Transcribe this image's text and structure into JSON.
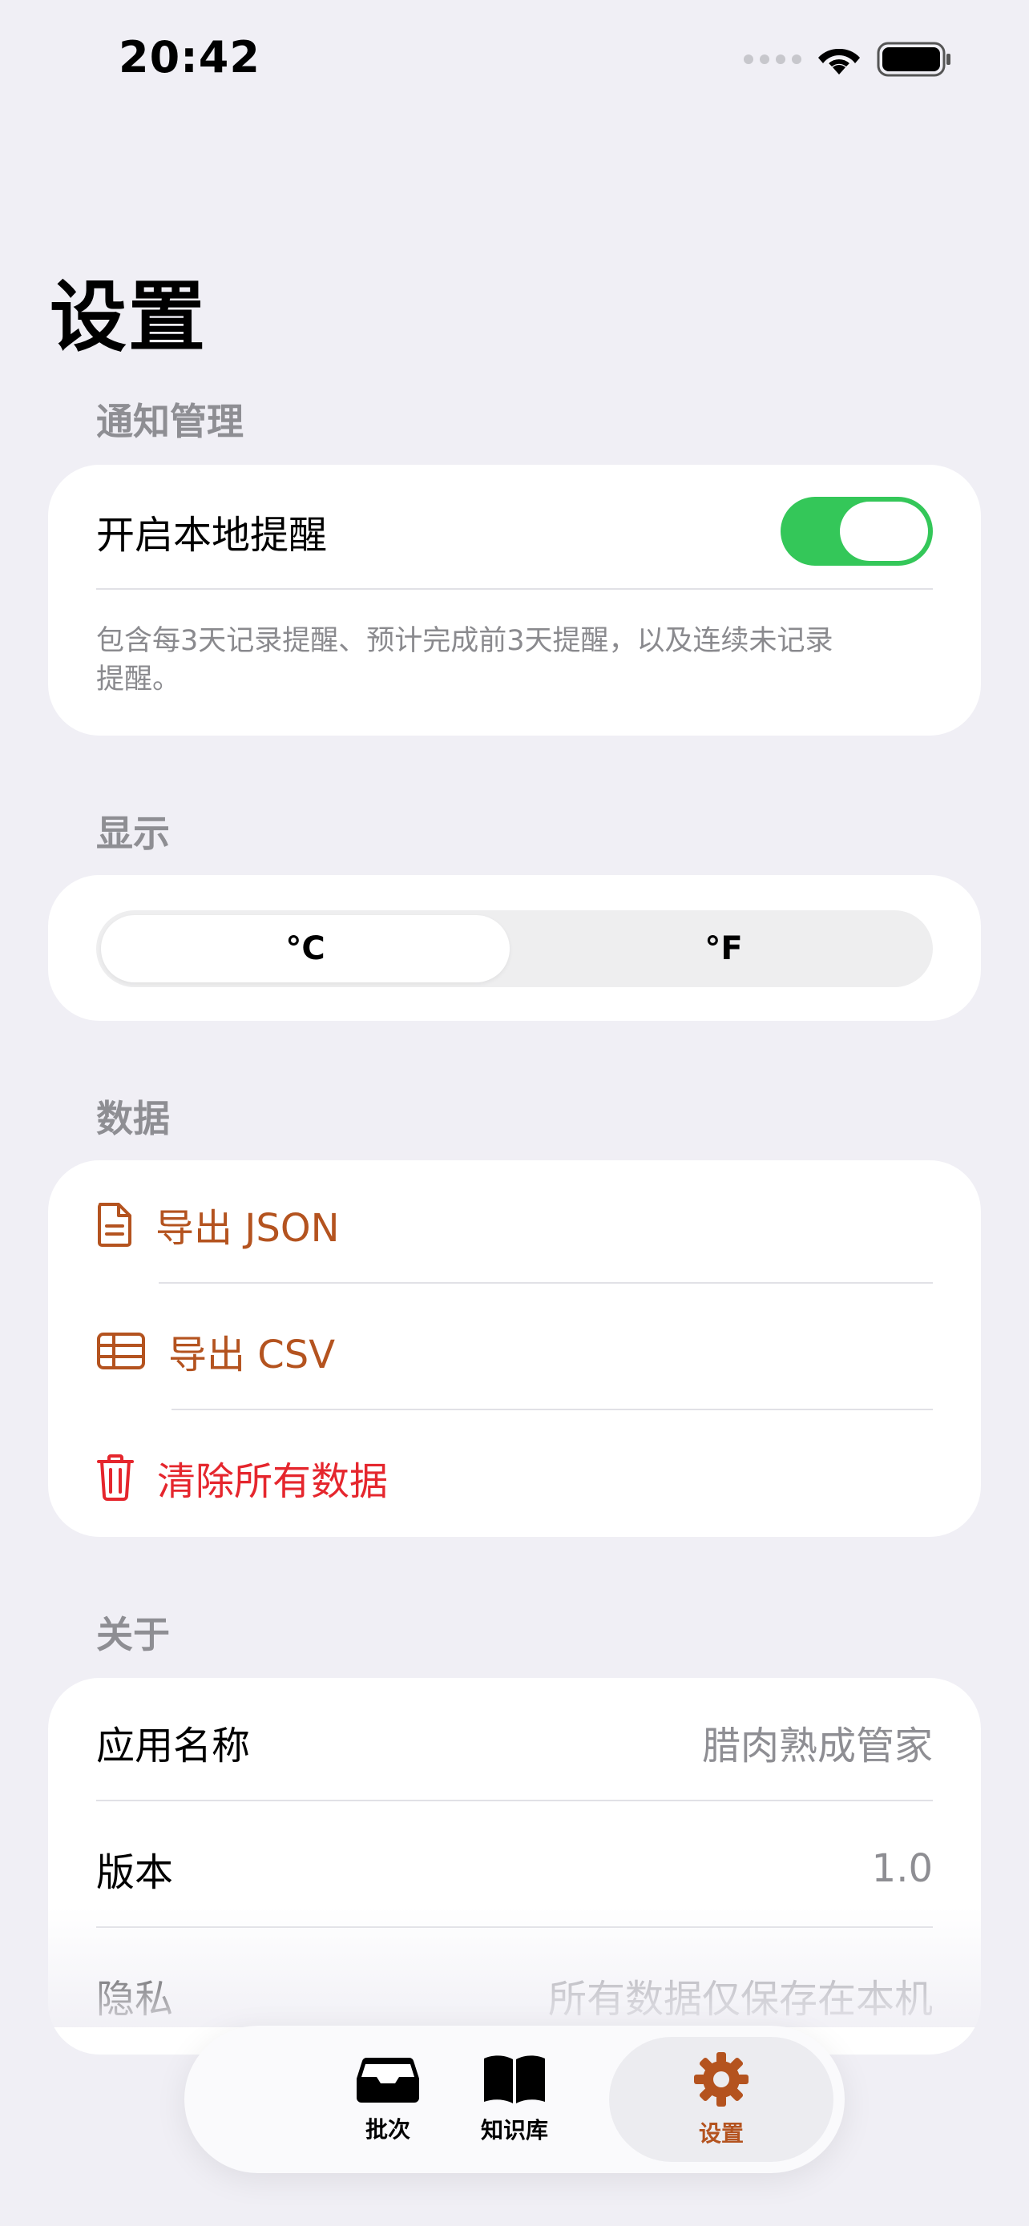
{
  "status_bar": {
    "time": "20:42"
  },
  "page": {
    "title": "设置"
  },
  "notifications": {
    "header": "通知管理",
    "toggle_label": "开启本地提醒",
    "toggle_on": true,
    "footnote": "包含每3天记录提醒、预计完成前3天提醒，以及连续未记录提醒。"
  },
  "display": {
    "header": "显示",
    "options": [
      "°C",
      "°F"
    ],
    "selected": "°C"
  },
  "data": {
    "header": "数据",
    "export_json": "导出 JSON",
    "export_csv": "导出 CSV",
    "clear_all": "清除所有数据"
  },
  "about": {
    "header": "关于",
    "rows": [
      {
        "label": "应用名称",
        "value": "腊肉熟成管家"
      },
      {
        "label": "版本",
        "value": "1.0"
      },
      {
        "label": "隐私",
        "value": "所有数据仅保存在本机"
      }
    ]
  },
  "tabbar": {
    "tabs": [
      {
        "label": "批次",
        "icon": "tray-icon"
      },
      {
        "label": "知识库",
        "icon": "book-icon"
      },
      {
        "label": "设置",
        "icon": "gear-icon"
      }
    ],
    "active": "设置"
  },
  "colors": {
    "accent": "#b4531f",
    "danger": "#e5262d",
    "toggle_on": "#34c759",
    "background": "#f0eff5"
  }
}
